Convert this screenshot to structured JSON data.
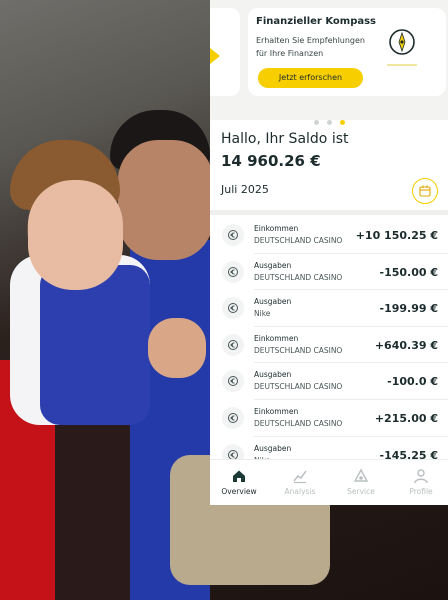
{
  "banner": {
    "title": "Finanzieller Kompass",
    "description": "Erhalten Sie Empfehlungen für Ihre Finanzen",
    "button": "Jetzt erforschen"
  },
  "greeting": "Hallo, Ihr Saldo ist",
  "balance": "14 960.26 €",
  "month": "Juli 2025",
  "transactions": [
    {
      "type": "Einkommen",
      "merchant": "DEUTSCHLAND CASINO",
      "amount": "+10 150.25 €"
    },
    {
      "type": "Ausgaben",
      "merchant": "DEUTSCHLAND CASINO",
      "amount": "-150.00 €"
    },
    {
      "type": "Ausgaben",
      "merchant": "Nike",
      "amount": "-199.99 €"
    },
    {
      "type": "Einkommen",
      "merchant": "DEUTSCHLAND CASINO",
      "amount": "+640.39 €"
    },
    {
      "type": "Ausgaben",
      "merchant": "DEUTSCHLAND CASINO",
      "amount": "-100.0 €"
    },
    {
      "type": "Einkommen",
      "merchant": "DEUTSCHLAND CASINO",
      "amount": "+215.00 €"
    },
    {
      "type": "Ausgaben",
      "merchant": "Nike",
      "amount": "-145.25 €"
    }
  ],
  "tabs": [
    {
      "label": "Overview",
      "icon": "home-icon",
      "active": true
    },
    {
      "label": "Analysis",
      "icon": "chart-icon",
      "active": false
    },
    {
      "label": "Service",
      "icon": "service-icon",
      "active": false
    },
    {
      "label": "Profile",
      "icon": "profile-icon",
      "active": false
    }
  ],
  "colors": {
    "accent": "#f7cf00",
    "text": "#1c2b2c",
    "inactive": "#b9bfc0"
  }
}
